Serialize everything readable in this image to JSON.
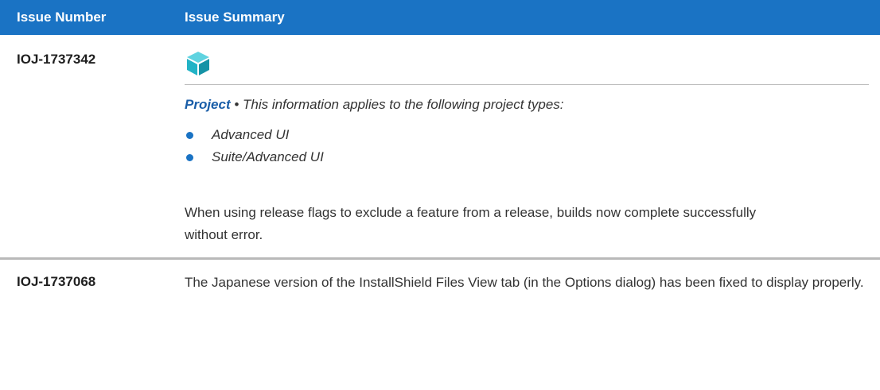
{
  "header": {
    "col_number": "Issue Number",
    "col_summary": "Issue Summary"
  },
  "rows": [
    {
      "issue_number": "IOJ-1737342",
      "icon": "cube-icon",
      "project_label": "Project",
      "applies_text": " • This information applies to the following project types:",
      "project_types": [
        "Advanced UI",
        "Suite/Advanced UI"
      ],
      "description": "When using release flags to exclude a feature from a release, builds now complete successfully without error."
    },
    {
      "issue_number": "IOJ-1737068",
      "description": "The Japanese version of the InstallShield Files View tab (in the Options dialog) has been fixed to display properly."
    }
  ],
  "colors": {
    "header_bg": "#1a73c4",
    "header_text": "#ffffff",
    "accent": "#1a5ea8",
    "icon_teal": "#22b3c6"
  }
}
